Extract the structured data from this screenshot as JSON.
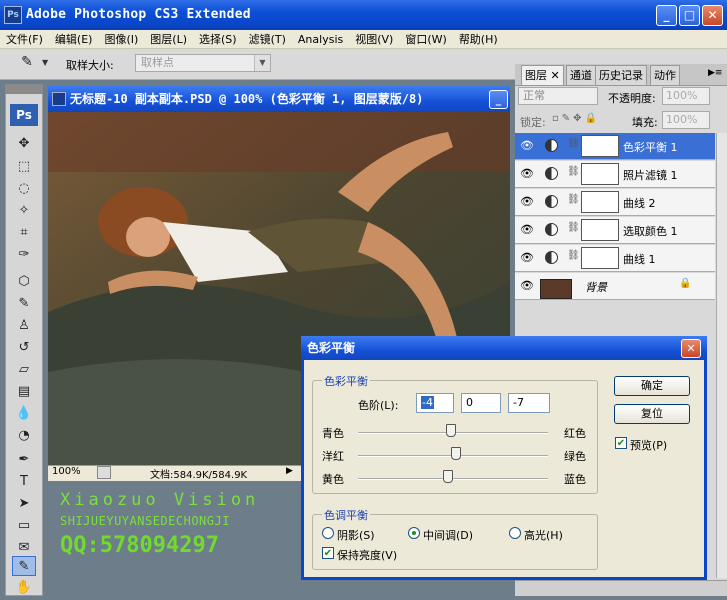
{
  "app": {
    "title": "Adobe Photoshop CS3 Extended",
    "logo": "Ps"
  },
  "menu": [
    "文件(F)",
    "编辑(E)",
    "图像(I)",
    "图层(L)",
    "选择(S)",
    "滤镜(T)",
    "Analysis",
    "视图(V)",
    "窗口(W)",
    "帮助(H)"
  ],
  "options": {
    "sample_label": "取样大小:",
    "sample_value": "取样点"
  },
  "document": {
    "title": "无标题-10 副本副本.PSD @ 100% (色彩平衡 1, 图层蒙版/8)",
    "zoom": "100%",
    "info": "文档:584.9K/584.9K"
  },
  "watermark": {
    "line1": "Xiaozuo Vision",
    "line2": "SHIJUEYUYANSEDECHONGJI",
    "line3": "QQ:578094297"
  },
  "panel": {
    "tabs": [
      "图层",
      "通道",
      "历史记录",
      "动作"
    ],
    "blend_mode": "正常",
    "opacity_label": "不透明度:",
    "opacity_value": "100%",
    "lock_label": "锁定:",
    "fill_label": "填充:",
    "fill_value": "100%",
    "layers": [
      {
        "name": "色彩平衡 1",
        "selected": true
      },
      {
        "name": "照片滤镜 1",
        "selected": false
      },
      {
        "name": "曲线 2",
        "selected": false
      },
      {
        "name": "选取颜色 1",
        "selected": false
      },
      {
        "name": "曲线 1",
        "selected": false
      },
      {
        "name": "背景",
        "selected": false
      }
    ]
  },
  "dialog": {
    "title": "色彩平衡",
    "color_balance_group": "色彩平衡",
    "levels_label": "色阶(L):",
    "levels": [
      "-4",
      "0",
      "-7"
    ],
    "sliders": [
      {
        "left": "青色",
        "right": "红色",
        "value": -4
      },
      {
        "left": "洋红",
        "right": "绿色",
        "value": 0
      },
      {
        "left": "黄色",
        "right": "蓝色",
        "value": -7
      }
    ],
    "tone_group": "色调平衡",
    "tones": {
      "shadows": "阴影(S)",
      "midtones": "中间调(D)",
      "highlights": "高光(H)",
      "selected": "midtones"
    },
    "preserve_luminosity": "保持亮度(V)",
    "ok": "确定",
    "reset": "复位",
    "preview": "预览(P)"
  },
  "colors": {
    "titlebar": "#0b4fd6",
    "watermark": "#79e03c",
    "selected_layer": "#3a6fd6"
  }
}
